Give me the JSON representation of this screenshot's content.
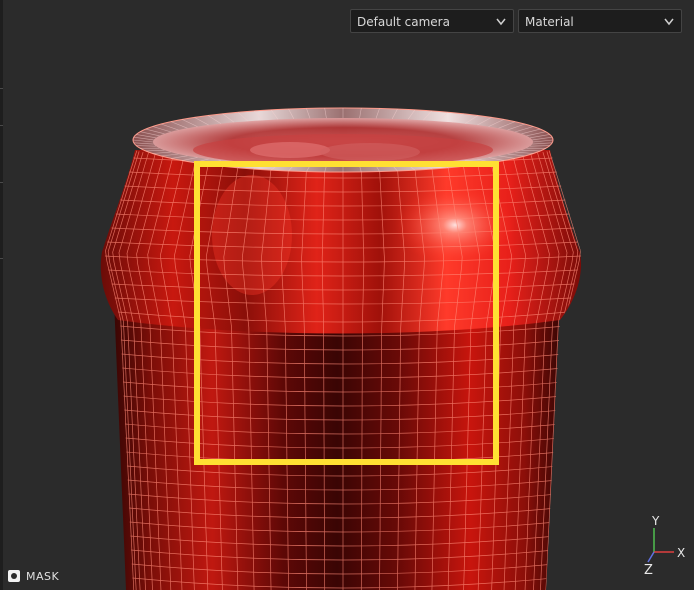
{
  "toolbar": {
    "camera_select": {
      "value": "Default camera"
    },
    "view_mode_select": {
      "value": "Material"
    }
  },
  "mask_toggle": {
    "label": "MASK"
  },
  "axis_gizmo": {
    "x_label": "X",
    "y_label": "Y",
    "z_label": "Z"
  },
  "colors": {
    "background": "#2b2b2b",
    "can_red": "#d0140c",
    "wireframe": "#ff8a78",
    "selection_yellow": "#ffe033",
    "axis_x": "#e04040",
    "axis_y": "#50c050",
    "axis_z": "#6070e0"
  }
}
